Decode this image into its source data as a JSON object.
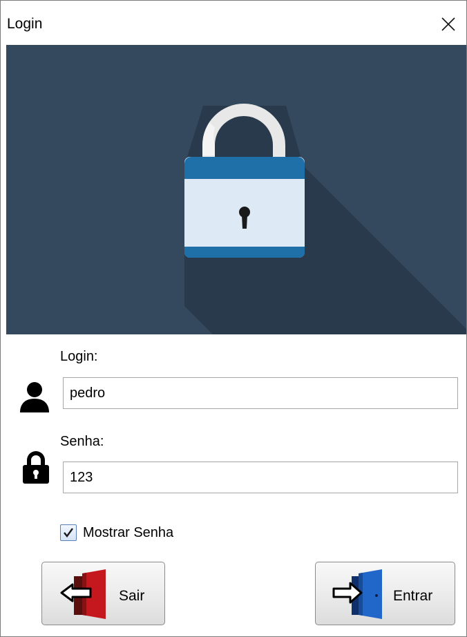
{
  "window": {
    "title": "Login",
    "close_icon": "close-icon"
  },
  "banner": {
    "icon": "padlock-icon",
    "background_color": "#34495e"
  },
  "form": {
    "login_label": "Login:",
    "login_value": "pedro",
    "login_icon": "user-icon",
    "password_label": "Senha:",
    "password_value": "123",
    "password_icon": "lock-icon",
    "show_password_label": "Mostrar Senha",
    "show_password_checked": true
  },
  "buttons": {
    "exit_label": "Sair",
    "exit_icon": "exit-door-icon",
    "enter_label": "Entrar",
    "enter_icon": "enter-door-icon"
  }
}
